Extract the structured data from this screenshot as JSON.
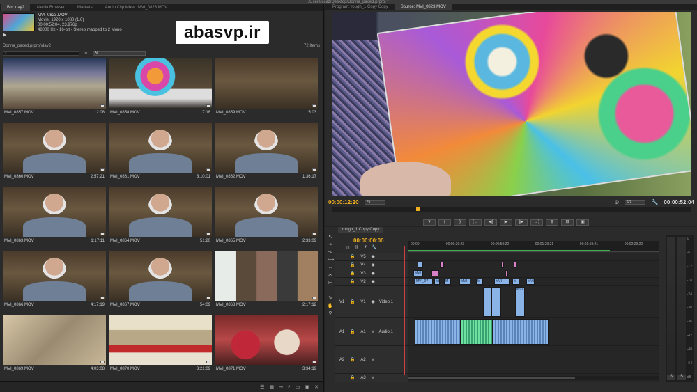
{
  "window": {
    "path": "/Users/ccaz/Desktop/Donna_paced.prproj *"
  },
  "project_panel": {
    "tabs": [
      "Bin: day2",
      "Media Browser",
      "Markers",
      "Audio Clip Mixer: MVI_0823.MOV"
    ],
    "clip_info": {
      "name": "MVI_0823.MOV",
      "line1": "Movie, 1920 x 1080 (1.0)",
      "line2": "00:00:52:04, 23.976p",
      "line3": "48000 Hz - 16-bit - Stereo mapped to 2 Mono"
    },
    "path": "Donna_paced.prproj\\day2",
    "item_count": "72 Items",
    "search_placeholder": "",
    "in_label": "In:",
    "in_value": "All",
    "bottom_icons": [
      "list-view-icon",
      "icon-view-icon",
      "zoom-icon",
      "search-icon",
      "new-bin-icon",
      "new-item-icon",
      "delete-icon"
    ]
  },
  "watermark": "abasvp.ir",
  "clips": [
    {
      "name": "MVI_0857.MOV",
      "duration": "12:08",
      "style": "t-sign"
    },
    {
      "name": "MVI_0858.MOV",
      "duration": "17:18",
      "style": "t-yarn"
    },
    {
      "name": "MVI_0859.MOV",
      "duration": "5:03",
      "style": "t-shop"
    },
    {
      "name": "MVI_0860.MOV",
      "duration": "2:57:21",
      "style": "person"
    },
    {
      "name": "MVI_0861.MOV",
      "duration": "3:10:01",
      "style": "person"
    },
    {
      "name": "MVI_0862.MOV",
      "duration": "1:36:17",
      "style": "person"
    },
    {
      "name": "MVI_0863.MOV",
      "duration": "1:17:11",
      "style": "person"
    },
    {
      "name": "MVI_0864.MOV",
      "duration": "51:20",
      "style": "person"
    },
    {
      "name": "MVI_0865.MOV",
      "duration": "2:33:09",
      "style": "person"
    },
    {
      "name": "MVI_0866.MOV",
      "duration": "4:17:19",
      "style": "person"
    },
    {
      "name": "MVI_0867.MOV",
      "duration": "54:09",
      "style": "person"
    },
    {
      "name": "MVI_0868.MOV",
      "duration": "2:17:12",
      "style": "t-street"
    },
    {
      "name": "MVI_0869.MOV",
      "duration": "4:03:08",
      "style": "t-cards"
    },
    {
      "name": "MVI_0870.MOV",
      "duration": "3:21:09",
      "style": "t-denial"
    },
    {
      "name": "MVI_0871.MOV",
      "duration": "3:34:19",
      "style": "t-pots"
    }
  ],
  "monitor": {
    "tabs": [
      "Program: rough_1 Copy Copy",
      "Source: MVI_0823.MOV"
    ],
    "timecode_in": "00:00:12:20",
    "fit_label": "Fit",
    "resolution": "1/2",
    "timecode_duration": "00:00:52:04",
    "controls": [
      "▼",
      "{",
      "}",
      "{←",
      "◀|",
      "▶",
      "|▶",
      "→}",
      "⊞",
      "⊟",
      "▣"
    ]
  },
  "timeline": {
    "tab": "rough_1 Copy Copy",
    "timecode": "00:00:00:00",
    "ruler_ticks": [
      "00:00",
      "00:00:29:23",
      "00:00:59:22",
      "00:01:29:21",
      "00:01:59:21",
      "00:02:29:20"
    ],
    "video_tracks": [
      {
        "src": "",
        "label": "V5"
      },
      {
        "src": "",
        "label": "V4"
      },
      {
        "src": "",
        "label": "V3"
      },
      {
        "src": "",
        "label": "V2"
      },
      {
        "src": "V1",
        "label": "V1",
        "name": "Video 1"
      }
    ],
    "audio_tracks": [
      {
        "src": "A1",
        "label": "A1",
        "name": "Audio 1"
      },
      {
        "src": "A2",
        "label": "A2"
      },
      {
        "src": "",
        "label": "A3"
      }
    ],
    "meter_scale": [
      "0",
      "-6",
      "-12",
      "-18",
      "-24",
      "-30",
      "-36",
      "-42",
      "-48",
      "-54",
      "dB"
    ],
    "meter_buttons": [
      "S",
      "S"
    ]
  }
}
